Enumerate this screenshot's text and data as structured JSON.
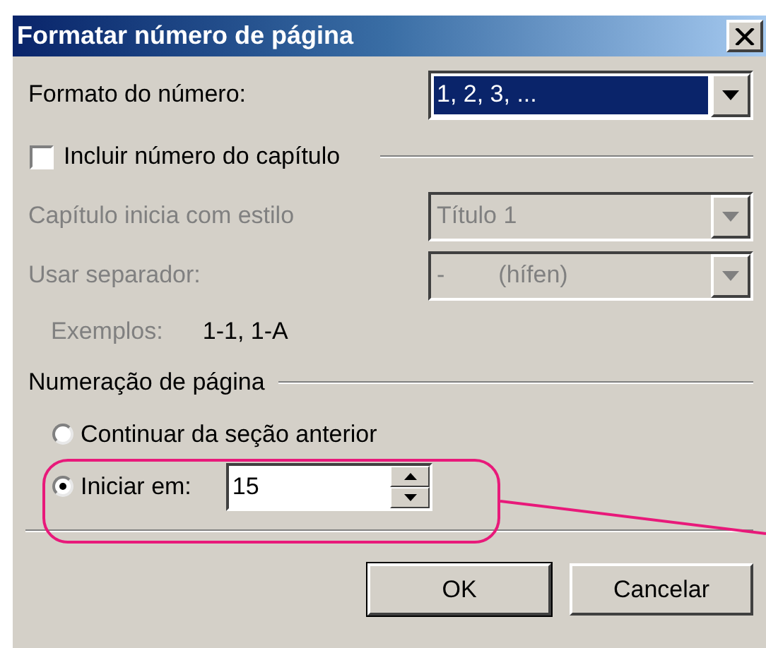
{
  "window": {
    "title": "Formatar número de página"
  },
  "number_format": {
    "label": "Formato do número:",
    "value": "1, 2, 3, ...",
    "highlighted": true,
    "disabled": false
  },
  "include_chapter": {
    "label": "Incluir número do capítulo",
    "checked": false
  },
  "chapter_style": {
    "label": "Capítulo inicia com estilo",
    "value": "Título 1",
    "disabled": true
  },
  "separator": {
    "label": "Usar separador:",
    "value": "-",
    "value_note": "(hífen)",
    "disabled": true
  },
  "examples": {
    "label": "Exemplos:",
    "value": "1-1, 1-A"
  },
  "page_numbering": {
    "heading": "Numeração de página",
    "options": [
      {
        "label": "Continuar da seção anterior",
        "selected": false
      },
      {
        "label": "Iniciar em:",
        "selected": true
      }
    ],
    "start_at": "15"
  },
  "buttons": [
    {
      "label": "OK"
    },
    {
      "label": "Cancelar"
    }
  ]
}
